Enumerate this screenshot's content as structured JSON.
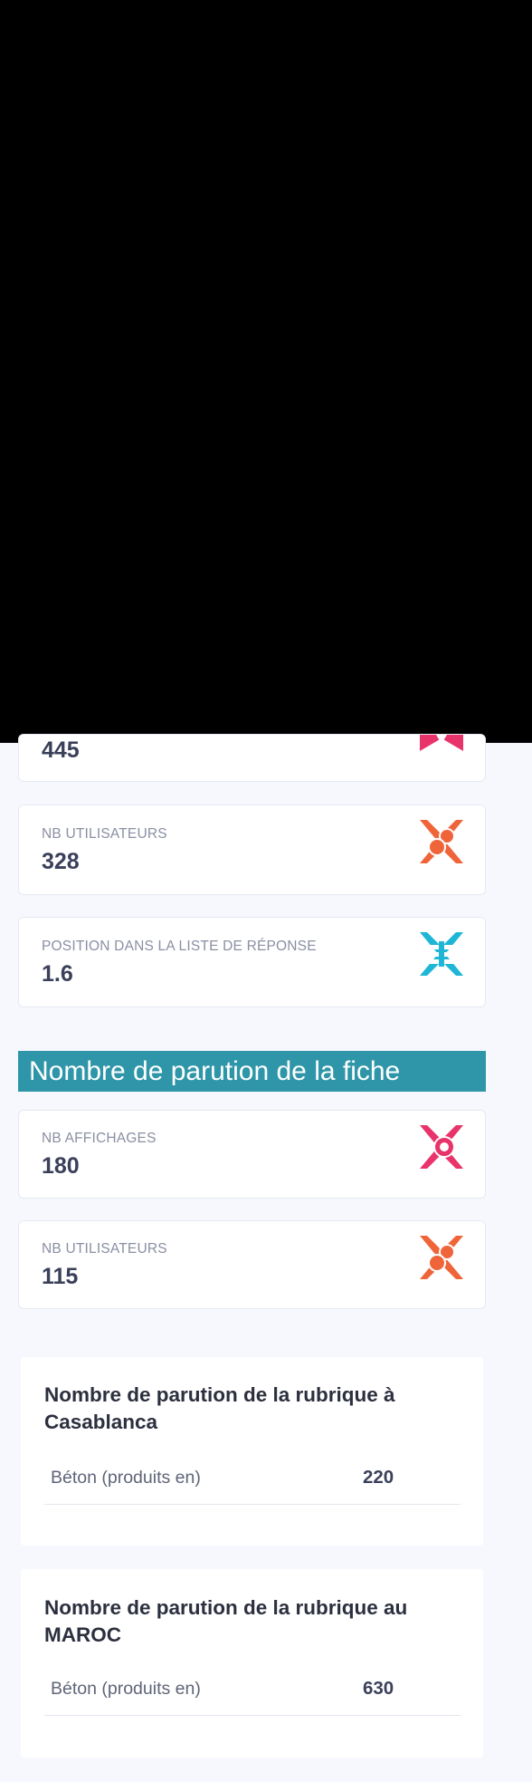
{
  "cards_top": {
    "partial_value": "445",
    "users": {
      "label": "NB UTILISATEURS",
      "value": "328"
    },
    "position": {
      "label": "POSITION DANS LA LISTE DE RÉPONSE",
      "value": "1.6"
    }
  },
  "section": {
    "title": "Nombre de parution de la fiche"
  },
  "cards_fiche": {
    "views": {
      "label": "NB AFFICHAGES",
      "value": "180"
    },
    "users": {
      "label": "NB UTILISATEURS",
      "value": "115"
    }
  },
  "panel_casablanca": {
    "title": "Nombre de parution de la rubrique à Casablanca",
    "rows": [
      {
        "label": "Béton (produits en)",
        "value": "220"
      }
    ]
  },
  "panel_maroc": {
    "title": "Nombre de parution de la rubrique au MAROC",
    "rows": [
      {
        "label": "Béton (produits en)",
        "value": "630"
      }
    ]
  },
  "colors": {
    "accent_header": "#2e96a8",
    "icon_pink": "#e8336b",
    "icon_orange": "#f0643a",
    "icon_cyan": "#1fb6d6"
  }
}
